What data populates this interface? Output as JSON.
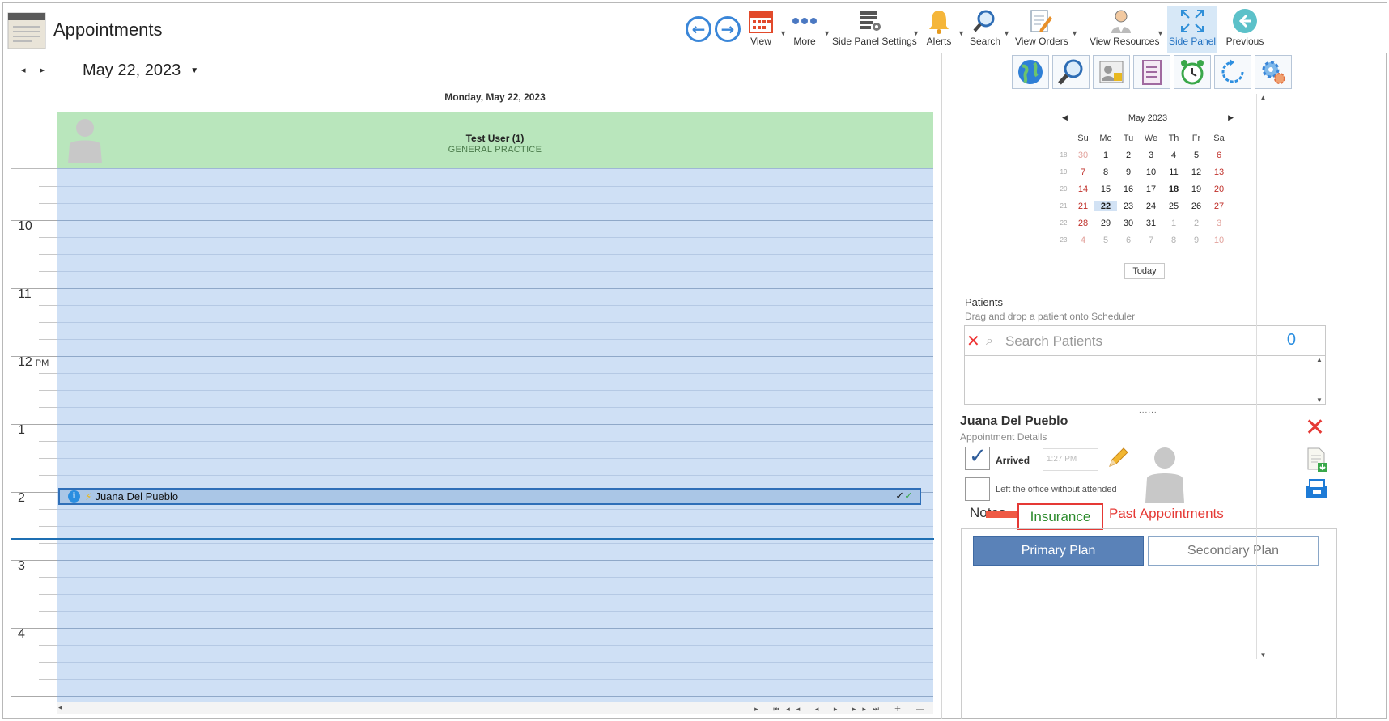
{
  "app": {
    "title": "Appointments"
  },
  "toolbar": {
    "view": "View",
    "more": "More",
    "side_panel_settings": "Side Panel Settings",
    "alerts": "Alerts",
    "search": "Search",
    "view_orders": "View Orders",
    "view_resources": "View Resources",
    "side_panel": "Side Panel",
    "previous": "Previous"
  },
  "scheduler": {
    "current_date": "May 22, 2023",
    "day_title": "Monday, May 22, 2023",
    "resource": {
      "name": "Test User (1)",
      "specialty": "GENERAL PRACTICE"
    },
    "hours": [
      "10",
      "11",
      "12",
      "1",
      "2",
      "3",
      "4"
    ],
    "pm_label": "PM",
    "appointment": {
      "patient": "Juana Del Pueblo"
    }
  },
  "mini_calendar": {
    "month_label": "May 2023",
    "dow": [
      "Su",
      "Mo",
      "Tu",
      "We",
      "Th",
      "Fr",
      "Sa"
    ],
    "weeks": [
      {
        "num": "18",
        "days": [
          "30",
          "1",
          "2",
          "3",
          "4",
          "5",
          "6"
        ]
      },
      {
        "num": "19",
        "days": [
          "7",
          "8",
          "9",
          "10",
          "11",
          "12",
          "13"
        ]
      },
      {
        "num": "20",
        "days": [
          "14",
          "15",
          "16",
          "17",
          "18",
          "19",
          "20"
        ]
      },
      {
        "num": "21",
        "days": [
          "21",
          "22",
          "23",
          "24",
          "25",
          "26",
          "27"
        ]
      },
      {
        "num": "22",
        "days": [
          "28",
          "29",
          "30",
          "31",
          "1",
          "2",
          "3"
        ]
      },
      {
        "num": "23",
        "days": [
          "4",
          "5",
          "6",
          "7",
          "8",
          "9",
          "10"
        ]
      }
    ],
    "today_button": "Today"
  },
  "patients": {
    "label": "Patients",
    "hint": "Drag and drop a patient onto Scheduler",
    "search_placeholder": "Search Patients",
    "count": "0"
  },
  "details": {
    "patient_name": "Juana Del Pueblo",
    "subtitle": "Appointment Details",
    "arrived_label": "Arrived",
    "arrived_time": "1:27 PM",
    "left_label": "Left the office without attended",
    "tabs": {
      "notes": "Notes",
      "insurance": "Insurance",
      "past": "Past Appointments"
    },
    "primary_plan": "Primary Plan",
    "secondary_plan": "Secondary Plan"
  },
  "colors": {
    "accent": "#3a86d8",
    "resource_header": "#b9e6bc",
    "slot_bg": "#cfe0f5",
    "highlight": "#e53935",
    "primary_plan": "#5a82b8"
  }
}
